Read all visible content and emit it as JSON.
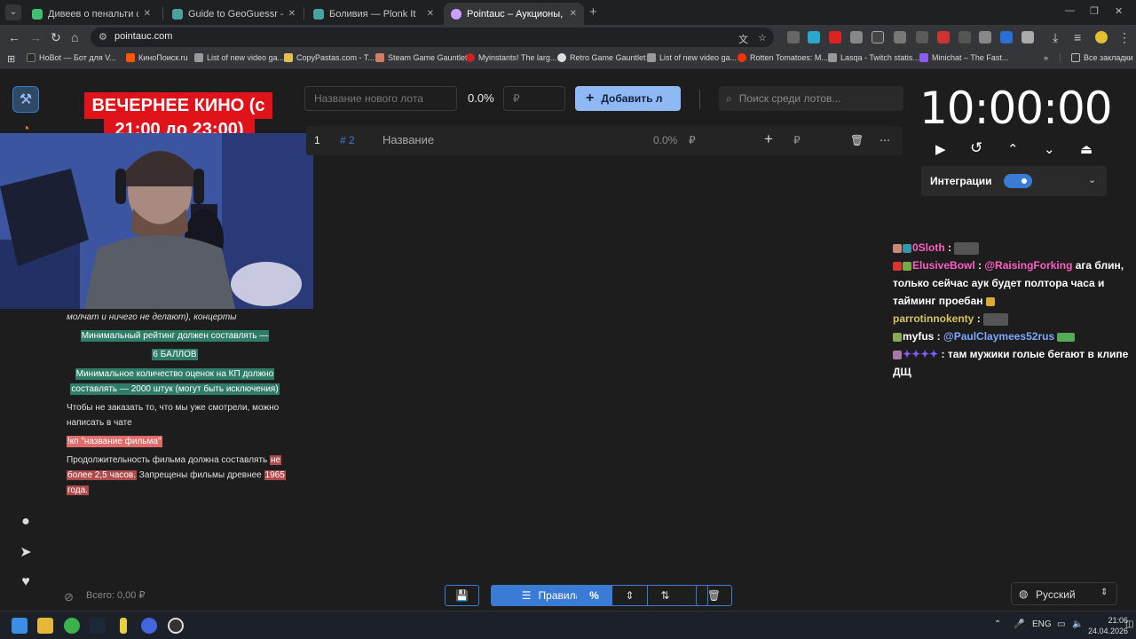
{
  "browser": {
    "tabs": [
      {
        "title": "Дивеев о пенальти с «Локо»",
        "fav_color": "#3fbf6f",
        "active": false
      },
      {
        "title": "Guide to GeoGuessr — Plonk It",
        "fav_color": "#4aa3a0",
        "active": false
      },
      {
        "title": "Боливия — Plonk It",
        "fav_color": "#4aa3a0",
        "active": false
      },
      {
        "title": "Pointauc – Аукционы, лотере",
        "fav_color": "#c9a0ff",
        "active": true
      }
    ],
    "url": "pointauc.com",
    "bookmarks": [
      {
        "label": "HoBot — Бот для V...",
        "color": "#2b2b2b"
      },
      {
        "label": "КиноПоиск.ru",
        "color": "#ff5500"
      },
      {
        "label": "List of new video ga...",
        "color": "#999999"
      },
      {
        "label": "CopyPastas.com - T...",
        "color": "#e0c050"
      },
      {
        "label": "Steam Game Gauntlet",
        "color": "#d08060"
      },
      {
        "label": "Myinstants! The larg...",
        "color": "#cc2222"
      },
      {
        "label": "Retro Game Gauntlet",
        "color": "#dddddd"
      },
      {
        "label": "List of new video ga...",
        "color": "#999999"
      },
      {
        "label": "Rotten Tomatoes: M...",
        "color": "#fa320a"
      },
      {
        "label": "Lasqa - Twitch statis...",
        "color": "#999999"
      },
      {
        "label": "Minichat – The Fast...",
        "color": "#8b5cf6"
      }
    ],
    "bookmarks_all": "Все закладки"
  },
  "rules": {
    "title_line1": "ВЕЧЕРНЕЕ КИНО (с",
    "title_line2": "21:00 до 23:00)",
    "line_concerts": "молчат и ничего не делают), концерты",
    "line_rating1": "Минимальный рейтинг должен составлять —",
    "line_rating2": "6 БАЛЛОВ",
    "line_votes1": "Минимальное количество оценок на КП должно",
    "line_votes2": "составлять — 2000 штук (могут быть исключения)",
    "line_order1": "Чтобы не заказать то, что мы уже смотрели, можно",
    "line_order2": "написать в чате",
    "line_cmd": "!кп \"название фильма\"",
    "line_dur1a": "Продолжительность фильма должна составлять ",
    "line_dur1b": "не",
    "line_dur2a": "более 2,5 часов.",
    "line_dur2b": " Запрещены фильмы древнее ",
    "line_dur2c": "1965",
    "line_dur3": "года."
  },
  "lots": {
    "new_lot_placeholder": "Название нового лота",
    "percent": "0.0%",
    "currency_placeholder": "₽",
    "add_button": "Добавить лот",
    "search_placeholder": "Поиск среди лотов...",
    "rows": [
      {
        "num": "1",
        "tag": "# 2",
        "name": "Название",
        "percent": "0.0%",
        "currency": "₽",
        "plus": "+",
        "currency2": "₽"
      }
    ]
  },
  "timer": {
    "display": "10:00:00",
    "integrations_label": "Интеграции",
    "integrations_on": true
  },
  "chat": [
    {
      "user": "0Sloth",
      "color": "#ff5ec4",
      "text": ":"
    },
    {
      "user": "ElusiveBowl",
      "color": "#ff5ec4",
      "mention": "@RaisingForking",
      "text": "ага блин, только сейчас аук будет полтора часа и тайминг проебан"
    },
    {
      "user": "parrotinnokenty",
      "color": "#d6c462",
      "text": ":"
    },
    {
      "user": "myfus",
      "color": "#ffffff",
      "mention": "@PaulClaymees52rus",
      "text": ""
    },
    {
      "user": "✦✦✦✦",
      "color": "#7b5cff",
      "text": "там мужики голые бегают в клипе ДЩ"
    }
  ],
  "footer": {
    "total": "Всего: 0,00 ₽",
    "rules_button": "Правила",
    "percent_icon": "%",
    "language": "Русский"
  },
  "taskbar": {
    "lang": "ENG",
    "time": "21:06",
    "date": "24.04.2026"
  }
}
